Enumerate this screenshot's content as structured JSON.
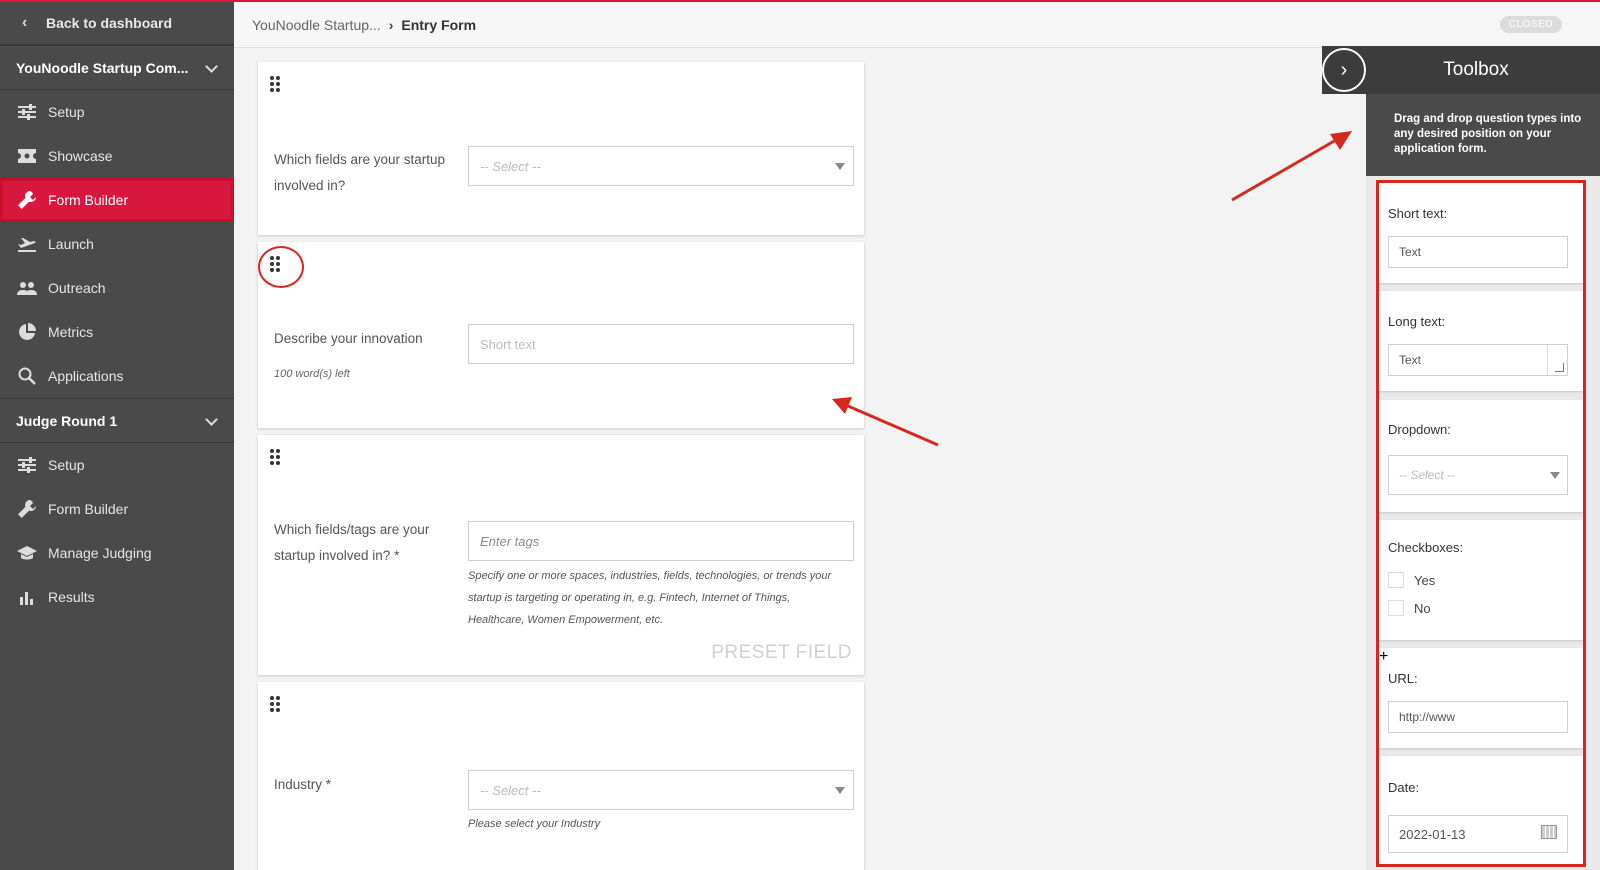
{
  "sidebar": {
    "back_label": "Back to dashboard",
    "section1_title": "YouNoodle Startup Com...",
    "section1_items": [
      {
        "label": "Setup",
        "icon": "sliders-icon"
      },
      {
        "label": "Showcase",
        "icon": "ticket-icon"
      },
      {
        "label": "Form Builder",
        "icon": "wrench-icon",
        "active": true
      },
      {
        "label": "Launch",
        "icon": "plane-takeoff-icon"
      },
      {
        "label": "Outreach",
        "icon": "people-icon"
      },
      {
        "label": "Metrics",
        "icon": "pie-chart-icon"
      },
      {
        "label": "Applications",
        "icon": "search-icon"
      }
    ],
    "section2_title": "Judge Round 1",
    "section2_items": [
      {
        "label": "Setup",
        "icon": "sliders-icon"
      },
      {
        "label": "Form Builder",
        "icon": "wrench-icon"
      },
      {
        "label": "Manage Judging",
        "icon": "graduation-cap-icon"
      },
      {
        "label": "Results",
        "icon": "bar-chart-icon"
      }
    ]
  },
  "header": {
    "breadcrumb_parent": "YouNoodle Startup...",
    "breadcrumb_current": "Entry Form",
    "status_badge": "CLOSED"
  },
  "form": {
    "q1": {
      "label_line1": "Which fields are your startup",
      "label_line2": "involved in?",
      "placeholder": "-- Select --"
    },
    "q2": {
      "label": "Describe your innovation",
      "hint": "100 word(s) left",
      "placeholder": "Short text"
    },
    "q3": {
      "label_line1": "Which fields/tags are your",
      "label_line2": "startup involved in? *",
      "placeholder": "Enter tags",
      "help_line1": "Specify one or more spaces, industries, fields, technologies, or trends your",
      "help_line2": "startup is targeting or operating in, e.g. Fintech, Internet of Things,",
      "help_line3": "Healthcare, Women Empowerment, etc.",
      "preset": "PRESET FIELD"
    },
    "q4": {
      "label": "Industry *",
      "placeholder": "-- Select --",
      "help": "Please select your Industry"
    }
  },
  "toolbox": {
    "title": "Toolbox",
    "description": "Drag and drop question types into any desired position on your application form.",
    "short_text": {
      "label": "Short text:",
      "value": "Text"
    },
    "long_text": {
      "label": "Long text:",
      "value": "Text"
    },
    "dropdown": {
      "label": "Dropdown:",
      "placeholder": "-- Select --"
    },
    "checkboxes": {
      "label": "Checkboxes:",
      "options": [
        "Yes",
        "No"
      ]
    },
    "url": {
      "label": "URL:",
      "value": "http://www"
    },
    "date": {
      "label": "Date:",
      "value": "2022-01-13"
    }
  },
  "colors": {
    "accent": "#d8173f",
    "annotation": "#d8271e",
    "sidebar": "#4a4a4a"
  }
}
